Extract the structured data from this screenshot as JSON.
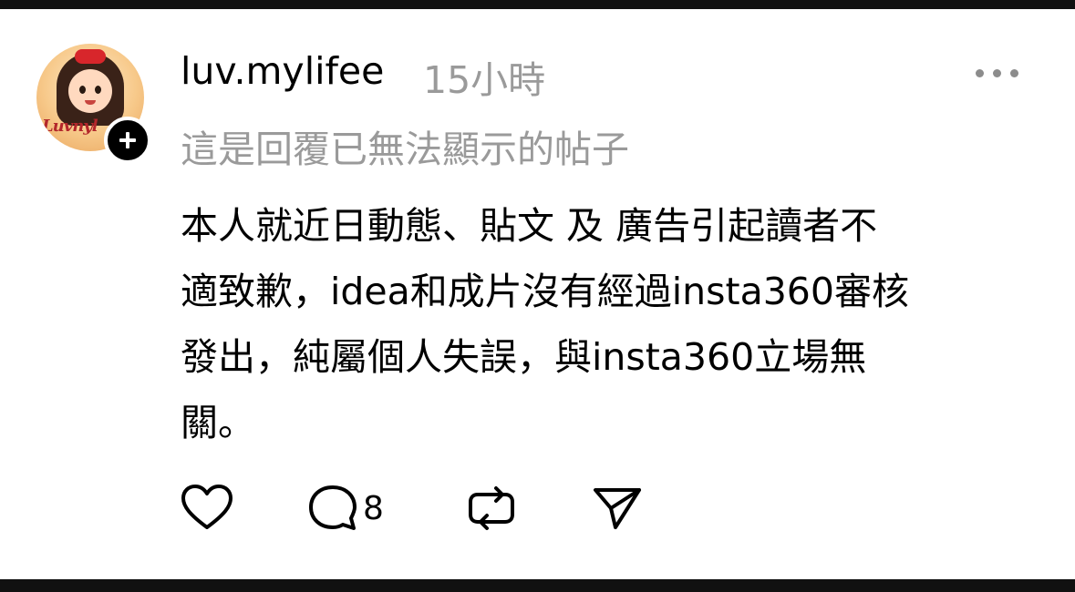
{
  "post": {
    "username": "luv.mylifee",
    "time": "15小時",
    "avatar_text": "Luvnyl",
    "reply_note": "這是回覆已無法顯示的帖子",
    "body_lines": [
      "本人就近日動態、貼文 及 廣告引起讀者不",
      "適致歉，idea和成片沒有經過insta360審核",
      "發出，純屬個人失誤，與insta360立場無",
      "關。"
    ]
  },
  "actions": {
    "like_icon": "heart-icon",
    "comment_icon": "comment-bubble-icon",
    "comment_count": "8",
    "repost_icon": "repost-icon",
    "share_icon": "send-icon"
  },
  "menu": {
    "icon": "more-horizontal-icon"
  },
  "follow": {
    "icon": "plus-icon"
  }
}
